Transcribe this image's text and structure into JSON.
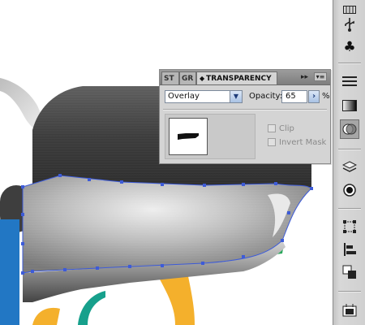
{
  "panel": {
    "tabs": [
      {
        "label": "ST",
        "active": false
      },
      {
        "label": "GR",
        "active": false
      },
      {
        "label": "TRANSPARENCY",
        "active": true
      }
    ],
    "collapse_label": "▸▸",
    "menu_label": "▾≡",
    "blend_mode": "Overlay",
    "opacity_label": "Opacity:",
    "opacity_value": "65",
    "percent_sign": "%",
    "clip_label": "Clip",
    "invert_mask_label": "Invert Mask",
    "clip_checked": false,
    "invert_mask_checked": false
  },
  "toolbar": {
    "icons": [
      "grid-icon",
      "usb-icon",
      "club-symbol-icon",
      "lines-icon",
      "gradient-icon",
      "transparency-icon",
      "layers-icon",
      "appearance-icon",
      "transform-icon",
      "align-icon",
      "pathfinder-icon",
      "artboards-icon"
    ],
    "selected": "transparency-icon"
  },
  "colors": {
    "panel_bg": "#d4d4d4",
    "selection_blue": "#3d5bd8",
    "art_blue": "#2277c4",
    "art_orange": "#f4b02c",
    "art_teal": "#17a08c",
    "art_green": "#2ba85c"
  }
}
